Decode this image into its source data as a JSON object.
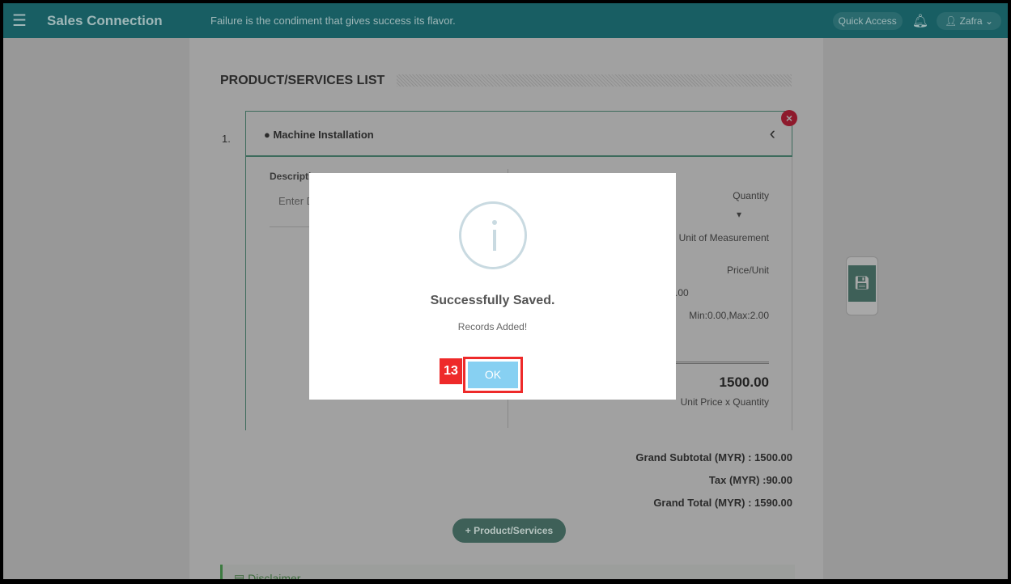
{
  "header": {
    "app_title": "Sales Connection",
    "quote": "Failure is the condiment that gives success its flavor.",
    "quick_access": "Quick Access",
    "user": "Zafra"
  },
  "section": {
    "title": "PRODUCT/SERVICES LIST"
  },
  "item": {
    "number": "1.",
    "name": "Machine Installation",
    "description_label": "Descripti",
    "description_placeholder": "Enter D",
    "quantity_label": "Quantity",
    "uom_label": "Unit of Measurement",
    "price_label": "Price/Unit",
    "price_value": ".00",
    "price_range": "Min:0.00,Max:2.00",
    "subtotal": "1500.00",
    "subtotal_label": "Unit Price x Quantity"
  },
  "totals": {
    "grand_subtotal": "Grand Subtotal (MYR) : 1500.00",
    "tax": "Tax (MYR) :90.00",
    "grand_total": "Grand Total (MYR) : 1590.00"
  },
  "add_button": "Product/Services",
  "disclaimer": "Disclaimer",
  "modal": {
    "title": "Successfully Saved.",
    "message": "Records Added!",
    "ok": "OK",
    "annotation": "13"
  },
  "colors": {
    "header": "#185e63",
    "ok_button": "#87d0f2",
    "annotation": "#ee2a2a"
  }
}
